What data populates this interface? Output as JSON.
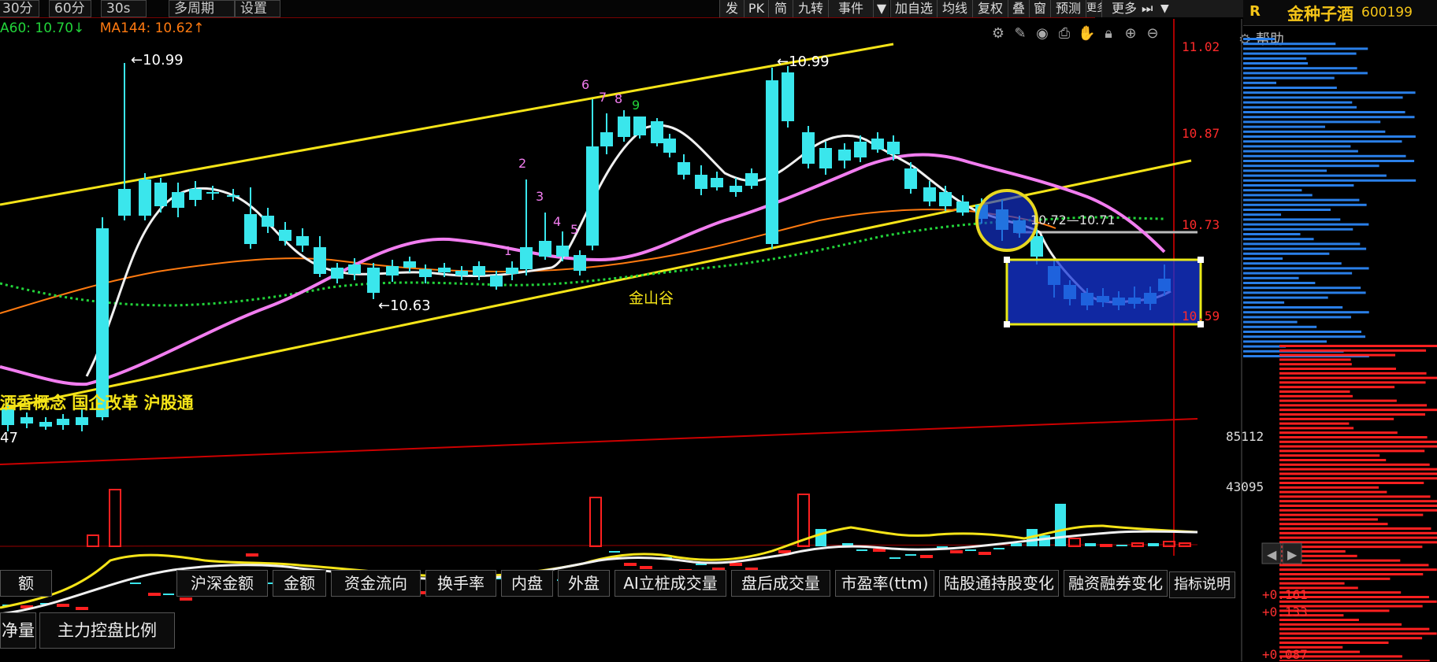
{
  "toolbar": {
    "period_tabs": [
      "30分",
      "60分",
      "30s",
      "多周期",
      "设置"
    ],
    "buttons": [
      "发",
      "PK",
      "简",
      "九转",
      "事件",
      "▼",
      "加自选",
      "均线",
      "复权",
      "叠",
      "窗",
      "预测",
      "更多",
      "⏭",
      "▼"
    ]
  },
  "ma_legend": {
    "ma60": "A60: 10.70↓",
    "ma144": "MA144: 10.62↑"
  },
  "chart_icons": [
    "settings-icon",
    "draw-icon",
    "eye-icon",
    "print-icon",
    "hand-icon",
    "lock-icon",
    "zoom-in-icon",
    "zoom-out-icon"
  ],
  "stock_header": {
    "r_label": "R",
    "name": "金种子酒",
    "code": "600199",
    "help_label": "帮助"
  },
  "price_axis": [
    "11.02",
    "10.87",
    "10.73",
    "10.59"
  ],
  "volume_axis": [
    "85112",
    "43095"
  ],
  "annotations": {
    "high_left": "10.99",
    "high_right": "10.99",
    "low_mid": "10.63",
    "left_edge_value": "47",
    "range_label": "10.72—10.71",
    "pattern_label": "金山谷",
    "concepts": "酒香概念  国企改革  沪股通"
  },
  "nine_turn_marks": [
    "1",
    "2",
    "3",
    "4",
    "5",
    "6",
    "7",
    "8",
    "9"
  ],
  "indicator_tabs_row1": [
    "额",
    "沪深金额",
    "金额",
    "资金流向",
    "换手率",
    "内盘",
    "外盘",
    "AI立桩成交量",
    "盘后成交量",
    "市盈率(ttm)",
    "陆股通持股变化",
    "融资融券变化"
  ],
  "indicator_help": "指标说明",
  "indicator_tabs_row2": [
    "净量",
    "主力控盘比例"
  ],
  "right_changes": [
    "+0.161",
    "+0.133",
    "+0.087"
  ],
  "colors": {
    "up": "#ff2020",
    "down": "#3ae6ec",
    "ma_white": "#f0f0f0",
    "ma_pink": "#f27df0",
    "ma_orange": "#ff7a10",
    "ma_green": "#22d43a",
    "trend_yellow": "#f5e418",
    "stock_name": "#f5c518"
  }
}
